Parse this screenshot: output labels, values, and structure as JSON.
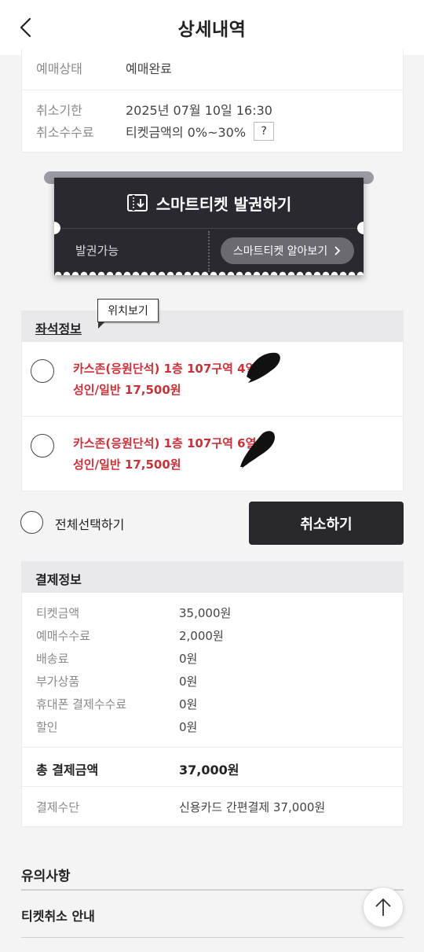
{
  "header": {
    "title": "상세내역"
  },
  "status": {
    "status_label": "예매상태",
    "status_value": "예매완료",
    "deadline_label": "취소기한",
    "deadline_value": "2025년 07월 10일 16:30",
    "fee_label": "취소수수료",
    "fee_value": "티켓금액의 0%~30%",
    "help_label": "?"
  },
  "ticket": {
    "issue_label": "스마트티켓 발권하기",
    "availability": "발권가능",
    "learn_more": "스마트티켓 알아보기"
  },
  "seats": {
    "section_title": "좌석정보",
    "tooltip": "위치보기",
    "items": [
      {
        "line1": "카스존(응원단석) 1층 107구역 4열",
        "line2": "성인/일반 17,500원"
      },
      {
        "line1": "카스존(응원단석) 1층 107구역 6열",
        "line2": "성인/일반 17,500원"
      }
    ],
    "select_all": "전체선택하기",
    "cancel": "취소하기"
  },
  "payment": {
    "section_title": "결제정보",
    "rows": [
      {
        "label": "티켓금액",
        "value": "35,000원"
      },
      {
        "label": "예매수수료",
        "value": "2,000원"
      },
      {
        "label": "배송료",
        "value": "0원"
      },
      {
        "label": "부가상품",
        "value": "0원"
      },
      {
        "label": "휴대폰 결제수수료",
        "value": "0원"
      },
      {
        "label": "할인",
        "value": "0원"
      }
    ],
    "total_label": "총 결제금액",
    "total_value": "37,000원",
    "method_label": "결제수단",
    "method_value": "신용카드 간편결제 37,000원"
  },
  "footer": {
    "notice_title": "유의사항",
    "cancel_guide": "티켓취소 안내"
  },
  "colors": {
    "accent_red": "#c8323a",
    "dark": "#28272c"
  }
}
